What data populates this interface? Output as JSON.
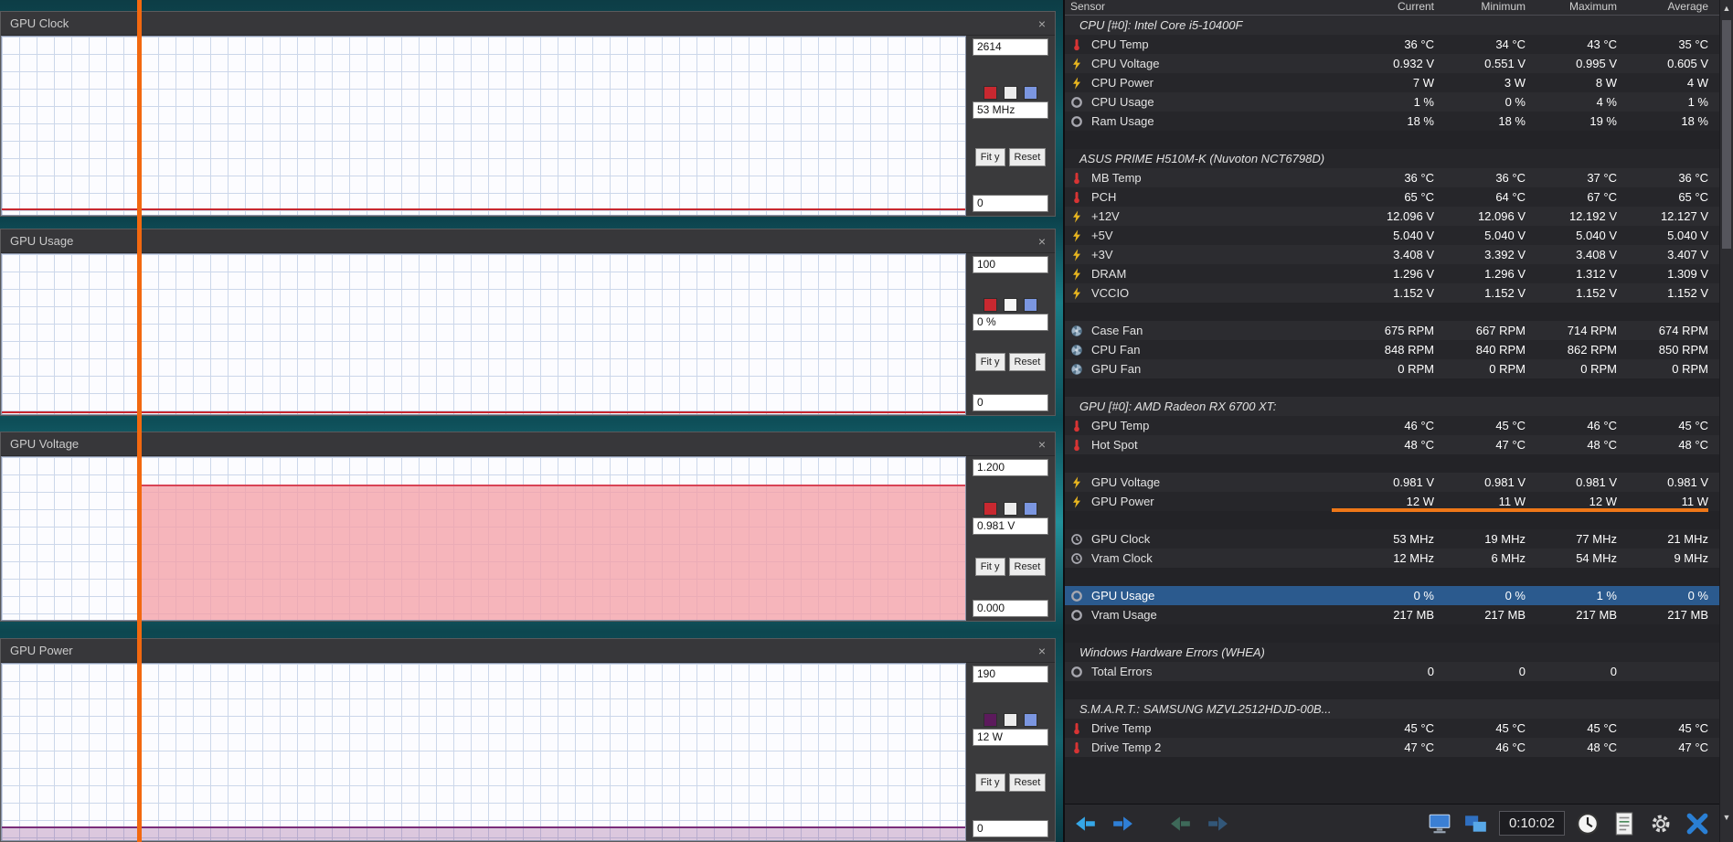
{
  "colors": {
    "cursor": "#f2680f",
    "selected_row": "#2b5a8e",
    "underline": "#ee7718",
    "accent_blue": "#2a7fd4"
  },
  "graph_controls": {
    "fit_label": "Fit y",
    "reset_label": "Reset"
  },
  "graphs": [
    {
      "title": "GPU Clock",
      "y_max": "2614",
      "current": "53 MHz",
      "y_min": "0",
      "line_color": "#c82830",
      "swatches": [
        "#c82830",
        "#ececec",
        "#7b96e0"
      ]
    },
    {
      "title": "GPU Usage",
      "y_max": "100",
      "current": "0 %",
      "y_min": "0",
      "line_color": "#c82830",
      "swatches": [
        "#c82830",
        "#f6f6f6",
        "#7b96e0"
      ]
    },
    {
      "title": "GPU Voltage",
      "y_max": "1.200",
      "current": "0.981 V",
      "y_min": "0.000",
      "line_color": "#d84355",
      "fill_color": "#f4a0a8",
      "swatches": [
        "#c82830",
        "#ececec",
        "#7b96e0"
      ]
    },
    {
      "title": "GPU Power",
      "y_max": "190",
      "current": "12 W",
      "y_min": "0",
      "line_color": "#7a2d7a",
      "swatches": [
        "#5c1a5c",
        "#ececec",
        "#7b96e0"
      ]
    }
  ],
  "sensor_table": {
    "columns": [
      "Sensor",
      "Current",
      "Minimum",
      "Maximum",
      "Average"
    ],
    "rows": [
      {
        "type": "group",
        "label": "CPU [#0]: Intel Core i5-10400F"
      },
      {
        "type": "row",
        "icon": "temp",
        "label": "CPU Temp",
        "values": [
          "36 °C",
          "34 °C",
          "43 °C",
          "35 °C"
        ]
      },
      {
        "type": "row",
        "icon": "volt",
        "label": "CPU Voltage",
        "values": [
          "0.932 V",
          "0.551 V",
          "0.995 V",
          "0.605 V"
        ]
      },
      {
        "type": "row",
        "icon": "volt",
        "label": "CPU Power",
        "values": [
          "7 W",
          "3 W",
          "8 W",
          "4 W"
        ]
      },
      {
        "type": "row",
        "icon": "gauge",
        "label": "CPU Usage",
        "values": [
          "1 %",
          "0 %",
          "4 %",
          "1 %"
        ]
      },
      {
        "type": "row",
        "icon": "gauge",
        "label": "Ram Usage",
        "values": [
          "18 %",
          "18 %",
          "19 %",
          "18 %"
        ]
      },
      {
        "type": "spacer"
      },
      {
        "type": "group",
        "label": "ASUS PRIME H510M-K (Nuvoton NCT6798D)"
      },
      {
        "type": "row",
        "icon": "temp",
        "label": "MB Temp",
        "values": [
          "36 °C",
          "36 °C",
          "37 °C",
          "36 °C"
        ]
      },
      {
        "type": "row",
        "icon": "temp",
        "label": "PCH",
        "values": [
          "65 °C",
          "64 °C",
          "67 °C",
          "65 °C"
        ]
      },
      {
        "type": "row",
        "icon": "volt",
        "label": "+12V",
        "values": [
          "12.096 V",
          "12.096 V",
          "12.192 V",
          "12.127 V"
        ]
      },
      {
        "type": "row",
        "icon": "volt",
        "label": "+5V",
        "values": [
          "5.040 V",
          "5.040 V",
          "5.040 V",
          "5.040 V"
        ]
      },
      {
        "type": "row",
        "icon": "volt",
        "label": "+3V",
        "values": [
          "3.408 V",
          "3.392 V",
          "3.408 V",
          "3.407 V"
        ]
      },
      {
        "type": "row",
        "icon": "volt",
        "label": "DRAM",
        "values": [
          "1.296 V",
          "1.296 V",
          "1.312 V",
          "1.309 V"
        ]
      },
      {
        "type": "row",
        "icon": "volt",
        "label": "VCCIO",
        "values": [
          "1.152 V",
          "1.152 V",
          "1.152 V",
          "1.152 V"
        ]
      },
      {
        "type": "spacer"
      },
      {
        "type": "row",
        "icon": "fan",
        "label": "Case Fan",
        "values": [
          "675 RPM",
          "667 RPM",
          "714 RPM",
          "674 RPM"
        ]
      },
      {
        "type": "row",
        "icon": "fan",
        "label": "CPU Fan",
        "values": [
          "848 RPM",
          "840 RPM",
          "862 RPM",
          "850 RPM"
        ]
      },
      {
        "type": "row",
        "icon": "fan",
        "label": "GPU Fan",
        "values": [
          "0 RPM",
          "0 RPM",
          "0 RPM",
          "0 RPM"
        ]
      },
      {
        "type": "spacer"
      },
      {
        "type": "group",
        "label": "GPU [#0]: AMD Radeon RX 6700 XT:"
      },
      {
        "type": "row",
        "icon": "temp",
        "label": "GPU Temp",
        "values": [
          "46 °C",
          "45 °C",
          "46 °C",
          "45 °C"
        ]
      },
      {
        "type": "row",
        "icon": "temp",
        "label": "Hot Spot",
        "values": [
          "48 °C",
          "47 °C",
          "48 °C",
          "48 °C"
        ]
      },
      {
        "type": "spacer"
      },
      {
        "type": "row",
        "icon": "volt",
        "label": "GPU Voltage",
        "values": [
          "0.981 V",
          "0.981 V",
          "0.981 V",
          "0.981 V"
        ]
      },
      {
        "type": "row",
        "icon": "volt",
        "label": "GPU Power",
        "values": [
          "12 W",
          "11 W",
          "12 W",
          "11 W"
        ],
        "underline": true
      },
      {
        "type": "spacer"
      },
      {
        "type": "row",
        "icon": "clock",
        "label": "GPU Clock",
        "values": [
          "53 MHz",
          "19 MHz",
          "77 MHz",
          "21 MHz"
        ]
      },
      {
        "type": "row",
        "icon": "clock",
        "label": "Vram Clock",
        "values": [
          "12 MHz",
          "6 MHz",
          "54 MHz",
          "9 MHz"
        ]
      },
      {
        "type": "spacer"
      },
      {
        "type": "row",
        "icon": "gauge",
        "label": "GPU Usage",
        "values": [
          "0 %",
          "0 %",
          "1 %",
          "0 %"
        ],
        "selected": true
      },
      {
        "type": "row",
        "icon": "gauge",
        "label": "Vram Usage",
        "values": [
          "217 MB",
          "217 MB",
          "217 MB",
          "217 MB"
        ]
      },
      {
        "type": "spacer"
      },
      {
        "type": "group",
        "label": "Windows Hardware Errors (WHEA)"
      },
      {
        "type": "row",
        "icon": "gauge",
        "label": "Total Errors",
        "values": [
          "0",
          "0",
          "0",
          ""
        ]
      },
      {
        "type": "spacer"
      },
      {
        "type": "group",
        "label": "S.M.A.R.T.: SAMSUNG MZVL2512HDJD-00B..."
      },
      {
        "type": "row",
        "icon": "temp",
        "label": "Drive Temp",
        "values": [
          "45 °C",
          "45 °C",
          "45 °C",
          "45 °C"
        ]
      },
      {
        "type": "row",
        "icon": "temp",
        "label": "Drive Temp 2",
        "values": [
          "47 °C",
          "46 °C",
          "48 °C",
          "47 °C"
        ]
      }
    ]
  },
  "statusbar": {
    "time": "0:10:02"
  }
}
